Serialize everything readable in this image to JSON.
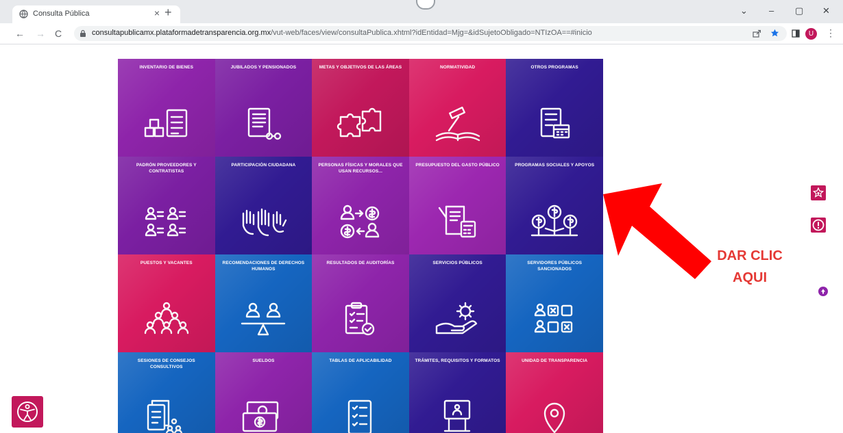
{
  "browser": {
    "tab_title": "Consulta Pública",
    "tab_close": "×",
    "new_tab": "+",
    "url_host": "consultapublicamx.plataformadetransparencia.org.mx",
    "url_path": "/vut-web/faces/view/consultaPublica.xhtml?idEntidad=Mjg=&idSujetoObligado=NTIzOA==#inicio",
    "nav": {
      "back": "←",
      "forward": "→",
      "reload": "C"
    },
    "window": {
      "chevron": "⌄",
      "minimize": "–",
      "restore": "▢",
      "close": "✕"
    },
    "avatar_letter": "U",
    "kebab": "⋮"
  },
  "tiles": [
    {
      "label": "INVENTARIO DE BIENES",
      "icon": "inventory-icon",
      "color": "#8e24aa"
    },
    {
      "label": "JUBILADOS Y PENSIONADOS",
      "icon": "retirees-document-icon",
      "color": "#7b1fa2"
    },
    {
      "label": "METAS Y OBJETIVOS DE LAS ÁREAS",
      "icon": "puzzle-icon",
      "color": "#c2185b"
    },
    {
      "label": "NORMATIVIDAD",
      "icon": "gavel-book-icon",
      "color": "#d81b60"
    },
    {
      "label": "OTROS PROGRAMAS",
      "icon": "calendar-document-icon",
      "color": "#311b92"
    },
    {
      "label": "PADRÓN PROVEEDORES Y CONTRATISTAS",
      "icon": "people-list-icon",
      "color": "#7b1fa2"
    },
    {
      "label": "PARTICIPACIÓN CIUDADANA",
      "icon": "raised-hands-icon",
      "color": "#311b92"
    },
    {
      "label": "PERSONAS FÍSICAS Y MORALES QUE USAN RECURSOS...",
      "icon": "person-money-exchange-icon",
      "color": "#8e24aa"
    },
    {
      "label": "PRESUPUESTO DEL GASTO PÚBLICO",
      "icon": "budget-calculator-icon",
      "color": "#9c27b0"
    },
    {
      "label": "PROGRAMAS SOCIALES Y APOYOS",
      "icon": "money-trees-icon",
      "color": "#311b92"
    },
    {
      "label": "PUESTOS Y VACANTES",
      "icon": "people-group-icon",
      "color": "#d81b60"
    },
    {
      "label": "RECOMENDACIONES DE DERECHOS HUMANOS",
      "icon": "balance-people-icon",
      "color": "#1565c0"
    },
    {
      "label": "RESULTADOS DE AUDITORÍAS",
      "icon": "audit-clipboard-icon",
      "color": "#8e24aa"
    },
    {
      "label": "SERVICIOS PÚBLICOS",
      "icon": "hand-gear-icon",
      "color": "#311b92"
    },
    {
      "label": "SERVIDORES PÚBLICOS SANCIONADOS",
      "icon": "sanctioned-people-icon",
      "color": "#1565c0"
    },
    {
      "label": "SESIONES DE CONSEJOS CONSULTIVOS",
      "icon": "sessions-documents-icon",
      "color": "#1565c0"
    },
    {
      "label": "SUELDOS",
      "icon": "salary-bills-icon",
      "color": "#8e24aa"
    },
    {
      "label": "TABLAS DE APLICABILIDAD",
      "icon": "checklist-icon",
      "color": "#1565c0"
    },
    {
      "label": "TRÁMITES, REQUISITOS Y FORMATOS",
      "icon": "kiosk-icon",
      "color": "#311b92"
    },
    {
      "label": "UNIDAD DE TRANSPARENCIA",
      "icon": "location-pin-icon",
      "color": "#d81b60"
    }
  ],
  "annotation": {
    "line1": "DAR CLIC",
    "line2": "AQUI",
    "color": "#e53935"
  },
  "floating": {
    "star_icon": "star-badge-icon",
    "alert_icon": "alert-icon",
    "accessibility_icon": "accessibility-icon"
  }
}
